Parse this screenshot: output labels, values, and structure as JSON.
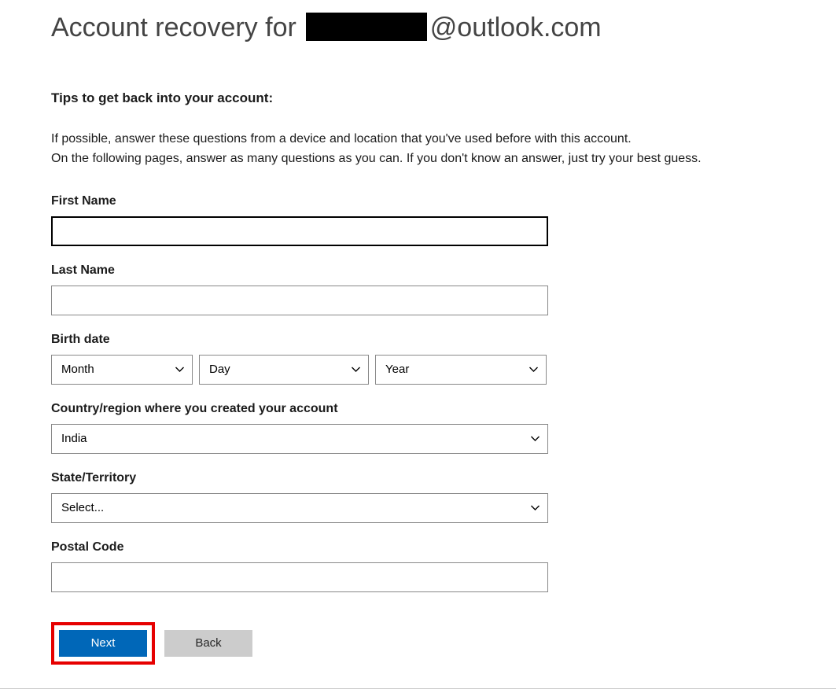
{
  "header": {
    "title_prefix": "Account recovery for",
    "email_suffix": "@outlook.com"
  },
  "tips": {
    "heading": "Tips to get back into your account:",
    "line1": "If possible, answer these questions from a device and location that you've used before with this account.",
    "line2": "On the following pages, answer as many questions as you can. If you don't know an answer, just try your best guess."
  },
  "form": {
    "first_name": {
      "label": "First Name",
      "value": ""
    },
    "last_name": {
      "label": "Last Name",
      "value": ""
    },
    "birth_date": {
      "label": "Birth date",
      "month": "Month",
      "day": "Day",
      "year": "Year"
    },
    "country": {
      "label": "Country/region where you created your account",
      "value": "India"
    },
    "state": {
      "label": "State/Territory",
      "value": "Select..."
    },
    "postal": {
      "label": "Postal Code",
      "value": ""
    }
  },
  "buttons": {
    "next": "Next",
    "back": "Back"
  }
}
